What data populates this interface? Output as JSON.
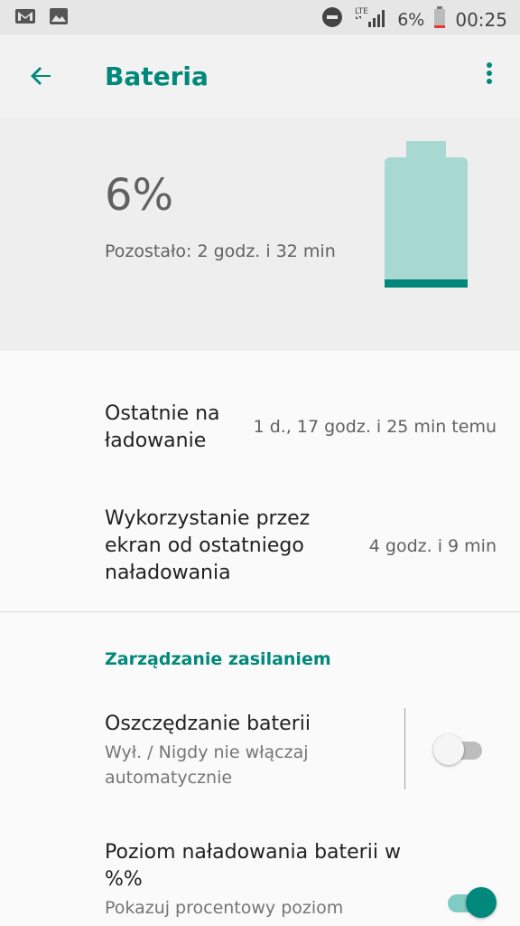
{
  "status_bar": {
    "battery_percent": "6%",
    "time": "00:25",
    "network_type": "LTE",
    "icons": [
      "gmail-icon",
      "image-icon",
      "do-not-disturb-icon",
      "signal-icon",
      "battery-low-icon"
    ]
  },
  "app_bar": {
    "title": "Bateria"
  },
  "battery_header": {
    "percent": "6%",
    "remaining": "Pozostało: 2 godz. i 32 min",
    "level": 0.06
  },
  "items": [
    {
      "title": "Ostatnie na ładowanie",
      "value": "1 d., 17 godz. i 25 min temu"
    },
    {
      "title": "Wykorzystanie przez ekran od ostatniego naładowania",
      "value": "4 godz. i 9 min"
    }
  ],
  "power_section": {
    "header": "Zarządzanie zasilaniem",
    "battery_saver": {
      "title": "Oszczędzanie baterii",
      "summary": "Wył. / Nigdy nie włączaj automatycznie",
      "enabled": false
    },
    "battery_percent": {
      "title": "Poziom naładowania baterii w %%",
      "summary": "Pokazuj procentowy poziom",
      "enabled": true
    }
  },
  "colors": {
    "accent": "#00897b",
    "battery_fill": "#a8d8d2"
  }
}
